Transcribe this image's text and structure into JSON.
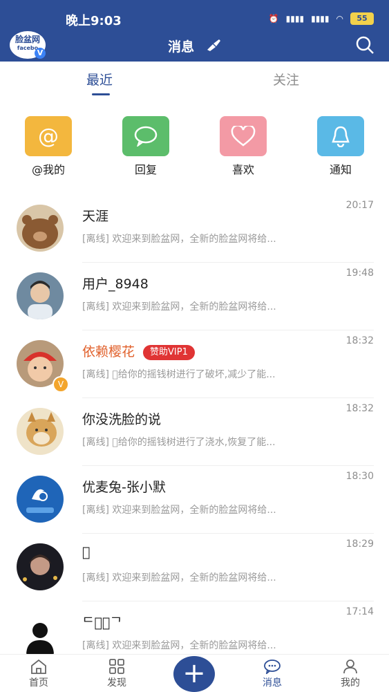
{
  "status_bar": {
    "time": "晚上9:03",
    "battery": "55"
  },
  "header": {
    "logo_text": "脸盆网",
    "logo_sub": "facebo",
    "title": "消息"
  },
  "tabs": [
    {
      "label": "最近"
    },
    {
      "label": "关注"
    }
  ],
  "quick_actions": [
    {
      "label": "@我的",
      "color": "#f3b73e"
    },
    {
      "label": "回复",
      "color": "#5cbd6b"
    },
    {
      "label": "喜欢",
      "color": "#f39aa5"
    },
    {
      "label": "通知",
      "color": "#5ab9e6"
    }
  ],
  "messages": [
    {
      "name": "天涯",
      "time": "20:17",
      "preview": "[离线] 欢迎来到脸盆网，全新的脸盆网将给..."
    },
    {
      "name": "用户_8948",
      "time": "19:48",
      "preview": "[离线] 欢迎来到脸盆网，全新的脸盆网将给..."
    },
    {
      "name": "依赖樱花",
      "badge": "赞助VIP1",
      "time": "18:32",
      "preview": "[离线] 􏰀给你的摇钱树进行了破坏,减少了能..."
    },
    {
      "name": "你没洗脸的说",
      "time": "18:32",
      "preview": "[离线] 􏰀给你的摇钱树进行了浇水,恢复了能..."
    },
    {
      "name": "优麦兔-张小默",
      "time": "18:30",
      "preview": "[离线] 欢迎来到脸盆网，全新的脸盆网将给..."
    },
    {
      "name": "􏰀",
      "time": "18:29",
      "preview": "[离线] 欢迎来到脸盆网，全新的脸盆网将给..."
    },
    {
      "name": "ᄃ􏰀􏰀ᄀ",
      "time": "17:14",
      "preview": "[离线] 欢迎来到脸盆网，全新的脸盆网将给..."
    }
  ],
  "bottom_nav": [
    {
      "label": "首页"
    },
    {
      "label": "发现"
    },
    {
      "label": "消息"
    },
    {
      "label": "我的"
    }
  ],
  "theme": {
    "primary": "#2d4e96",
    "vip_name": "#e1612c",
    "vip_badge": "#e03434"
  }
}
